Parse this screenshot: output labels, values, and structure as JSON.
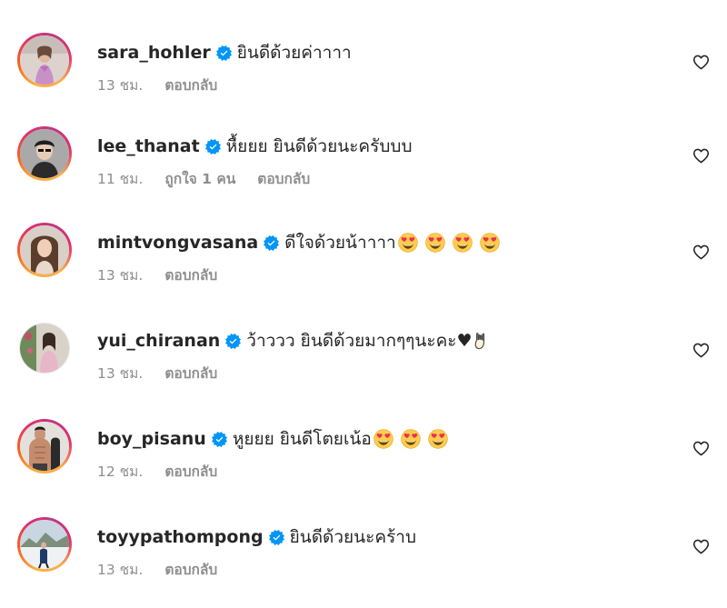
{
  "icons": {
    "verified": "verified-badge-icon",
    "like": "heart-outline-icon",
    "emoji_heart_eyes": "heart-eyes-emoji",
    "emoji_rock_hand": "rock-on-hand-emoji"
  },
  "colors": {
    "verified_blue": "#0095f6",
    "text": "#262626",
    "meta": "#8e8e8e"
  },
  "comments": [
    {
      "username": "sara_hohler",
      "text": "ยินดีด้วยค่าาาา",
      "time": "13 ชม.",
      "likes": "",
      "reply": "ตอบกลับ"
    },
    {
      "username": "lee_thanat",
      "text": "หื้ยยย ยินดีด้วยนะครับบบ",
      "time": "11 ชม.",
      "likes": "ถูกใจ 1 คน",
      "reply": "ตอบกลับ"
    },
    {
      "username": "mintvongvasana",
      "text": "ดีใจด้วยน้าาาา",
      "time": "13 ชม.",
      "likes": "",
      "reply": "ตอบกลับ"
    },
    {
      "username": "yui_chiranan",
      "text": "ว้าววว ยินดีด้วยมากๆๆนะคะ♥",
      "time": "13 ชม.",
      "likes": "",
      "reply": "ตอบกลับ"
    },
    {
      "username": "boy_pisanu",
      "text": "หูยยย ยินดีโตยเน้อ",
      "time": "12 ชม.",
      "likes": "",
      "reply": "ตอบกลับ"
    },
    {
      "username": "toyypathompong",
      "text": "ยินดีด้วยนะคร้าบ",
      "time": "13 ชม.",
      "likes": "",
      "reply": "ตอบกลับ"
    }
  ]
}
